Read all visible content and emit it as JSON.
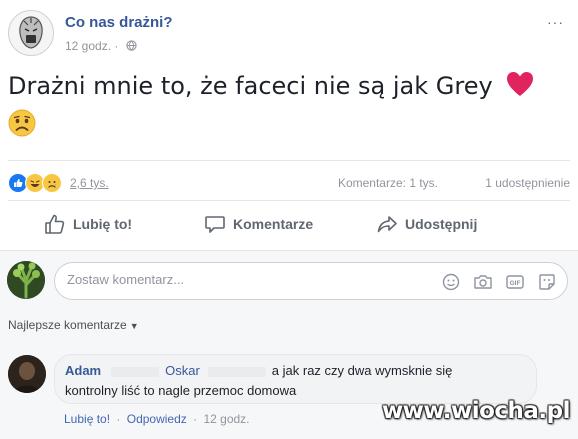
{
  "post": {
    "page_name": "Co nas drażni?",
    "time": "12 godz.",
    "more_label": "···",
    "text": "Drażni mnie to, że faceci nie są jak Grey",
    "emojis": [
      "heart-icon",
      "sad-face-icon"
    ]
  },
  "stats": {
    "reactions": [
      "like-reaction-icon",
      "haha-reaction-icon",
      "sad-reaction-icon"
    ],
    "reaction_count": "2,6 tys.",
    "comments": "Komentarze: 1 tys.",
    "shares": "1 udostępnienie"
  },
  "actions": {
    "like": "Lubię to!",
    "comment": "Komentarze",
    "share": "Udostępnij"
  },
  "comment_box": {
    "placeholder": "Zostaw komentarz...",
    "icons": [
      "emoji-icon",
      "camera-icon",
      "gif-icon",
      "sticker-icon"
    ]
  },
  "sort": {
    "label": "Najlepsze komentarze"
  },
  "top_comment": {
    "author": "Adam",
    "tagged": "Oskar",
    "text_line1": "a jak raz czy dwa wymsknie się",
    "text_line2": "kontrolny liść to nagle przemoc domowa",
    "like": "Lubię to!",
    "reply": "Odpowiedz",
    "separator": "·",
    "time": "12 godz."
  },
  "watermark": "www.wiocha.pl",
  "colors": {
    "link_blue": "#365899",
    "muted": "#90949c",
    "like_blue": "#1877f2",
    "heart_red": "#e0245e",
    "emoji_yellow": "#f7c744"
  }
}
